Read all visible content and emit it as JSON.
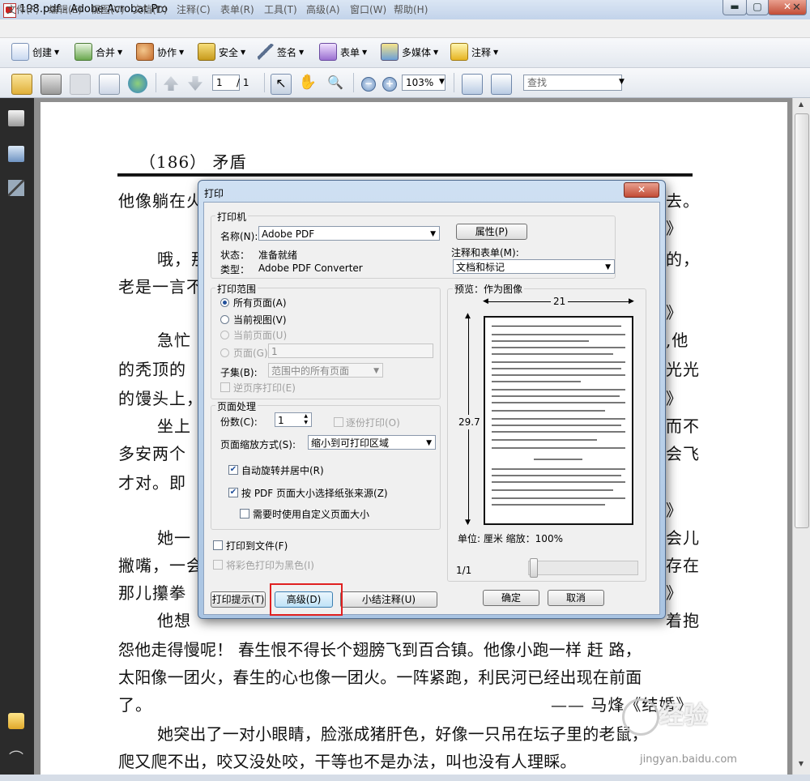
{
  "window": {
    "title": "198.pdf - Adobe Acrobat Pro",
    "min": "▬",
    "max": "▢",
    "close": "✕",
    "doc_close": "✕"
  },
  "menu": [
    "文件(F)",
    "编辑(E)",
    "视图(V)",
    "文档(D)",
    "注释(C)",
    "表单(R)",
    "工具(T)",
    "高级(A)",
    "窗口(W)",
    "帮助(H)"
  ],
  "toolbar1": [
    {
      "label": "创建",
      "icon": "create-pdf-icon"
    },
    {
      "label": "合并",
      "icon": "combine-icon"
    },
    {
      "label": "协作",
      "icon": "collaborate-icon"
    },
    {
      "label": "安全",
      "icon": "lock-icon"
    },
    {
      "label": "签名",
      "icon": "pen-icon"
    },
    {
      "label": "表单",
      "icon": "form-icon"
    },
    {
      "label": "多媒体",
      "icon": "multimedia-icon"
    },
    {
      "label": "注释",
      "icon": "comment-icon"
    }
  ],
  "toolbar2": {
    "page_current": "1",
    "page_total": "/ 1",
    "zoom": "103%",
    "search_placeholder": "查找"
  },
  "document": {
    "header": "（186） 矛盾",
    "lines": [
      "他像躺在火",
      "哦，那",
      "老是一言不",
      "急忙",
      "的秃顶的",
      "的馒头上，",
      "坐上",
      "多安两个",
      "才对。即",
      "她一",
      "撇嘴，一会",
      "那儿攥拳",
      "他想",
      "怨他走得慢呢！ 春生恨不得长个翅膀飞到百合镇。他像小跑一样 赶 路，",
      "太阳像一团火，春生的心也像一团火。一阵紧跑，利民河已经出现在前面",
      "了。",
      "—— 马烽《结婚》",
      "她突出了一对小眼睛，脸涨成猪肝色，好像一只吊在坛子里的老鼠，",
      "爬又爬不出，咬又没处咬，干等也不是办法，叫也没有人理睬。"
    ],
    "right_fragments": [
      "去。",
      "》",
      "的，",
      "》",
      ",他",
      "光光",
      "》",
      "而不",
      "会飞",
      "》",
      "会儿",
      "存在",
      "》",
      "着抱"
    ]
  },
  "dialog": {
    "title": "打印",
    "close": "✕",
    "printer": {
      "legend": "打印机",
      "name_label": "名称(N):",
      "name_value": "Adobe PDF",
      "status_label": "状态：",
      "status_value": "准备就绪",
      "type_label": "类型：",
      "type_value": "Adobe PDF Converter",
      "properties_button": "属性(P)",
      "comments_label": "注释和表单(M):",
      "comments_value": "文档和标记"
    },
    "range": {
      "legend": "打印范围",
      "all": "所有页面(A)",
      "current_view": "当前视图(V)",
      "current_page": "当前页面(U)",
      "pages": "页面(G)",
      "pages_value": "1",
      "subset_label": "子集(B):",
      "subset_value": "范围中的所有页面",
      "reverse": "逆页序打印(E)"
    },
    "handling": {
      "legend": "页面处理",
      "copies_label": "份数(C):",
      "copies_value": "1",
      "collate": "逐份打印(O)",
      "scaling_label": "页面缩放方式(S):",
      "scaling_value": "缩小到可打印区域",
      "auto_rotate": "自动旋转并居中(R)",
      "choose_source": "按 PDF 页面大小选择纸张来源(Z)",
      "custom_size": "需要时使用自定义页面大小"
    },
    "print_to_file": "打印到文件(F)",
    "grayscale": "将彩色打印为黑色(I)",
    "preview": {
      "label": "预览：作为图像",
      "width": "21",
      "height": "29.7",
      "unit_zoom": "单位: 厘米 缩放：100%",
      "page_indicator": "1/1"
    },
    "buttons": {
      "tips": "打印提示(T)",
      "advanced": "高级(D)",
      "summarize": "小结注释(U)",
      "ok": "确定",
      "cancel": "取消"
    }
  },
  "watermark": {
    "text": "经验",
    "url": "jingyan.baidu.com"
  }
}
